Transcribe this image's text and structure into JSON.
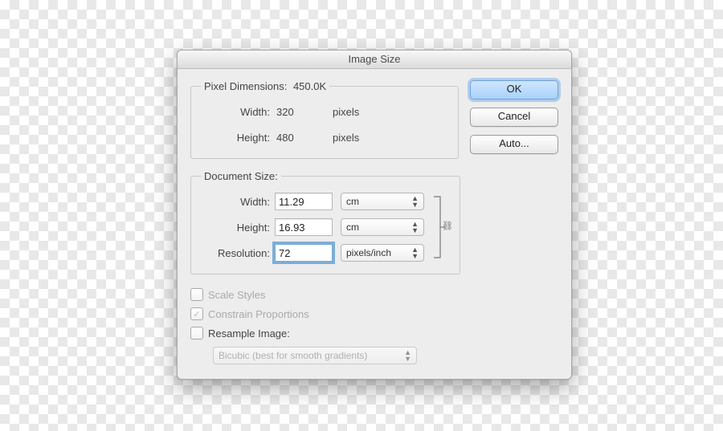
{
  "dialog": {
    "title": "Image Size"
  },
  "pixelDimensions": {
    "legend": "Pixel Dimensions:",
    "sizeSummary": "450.0K",
    "widthLabel": "Width:",
    "widthValue": "320",
    "widthUnit": "pixels",
    "heightLabel": "Height:",
    "heightValue": "480",
    "heightUnit": "pixels"
  },
  "documentSize": {
    "legend": "Document Size:",
    "widthLabel": "Width:",
    "widthValue": "11.29",
    "widthUnit": "cm",
    "heightLabel": "Height:",
    "heightValue": "16.93",
    "heightUnit": "cm",
    "resolutionLabel": "Resolution:",
    "resolutionValue": "72",
    "resolutionUnit": "pixels/inch"
  },
  "options": {
    "scaleStyles": {
      "label": "Scale Styles",
      "checked": false,
      "enabled": false
    },
    "constrainProportions": {
      "label": "Constrain Proportions",
      "checked": true,
      "enabled": false
    },
    "resampleImage": {
      "label": "Resample Image:",
      "checked": false,
      "enabled": true
    },
    "resampleMethod": "Bicubic (best for smooth gradients)"
  },
  "buttons": {
    "ok": "OK",
    "cancel": "Cancel",
    "auto": "Auto..."
  },
  "icons": {
    "linkIcon": "link-icon",
    "caretUpDown": "updown-caret-icon"
  }
}
